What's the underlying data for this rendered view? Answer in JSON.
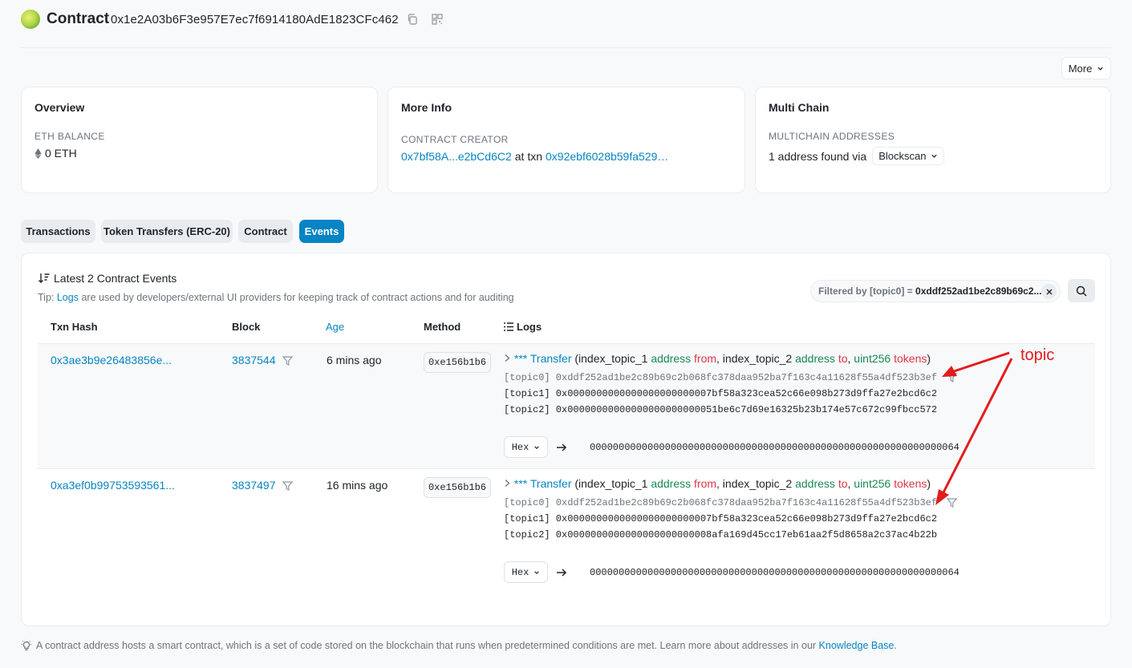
{
  "header": {
    "title": "Contract",
    "address": "0x1e2A03b6F3e957E7ec7f6914180AdE1823CFc462"
  },
  "more_button": "More",
  "overview": {
    "title": "Overview",
    "balance_label": "ETH BALANCE",
    "balance_value": "0 ETH"
  },
  "more_info": {
    "title": "More Info",
    "creator_label": "CONTRACT CREATOR",
    "creator_address": "0x7bf58A...e2bCd6C2",
    "at_txn": "at txn",
    "creator_txn": "0x92ebf6028b59fa529…"
  },
  "multi_chain": {
    "title": "Multi Chain",
    "label": "MULTICHAIN ADDRESSES",
    "value": "1 address found via",
    "dropdown": "Blockscan"
  },
  "tabs": [
    {
      "label": "Transactions"
    },
    {
      "label": "Token Transfers (ERC-20)"
    },
    {
      "label": "Contract"
    },
    {
      "label": "Events"
    }
  ],
  "events": {
    "title": "Latest 2 Contract Events",
    "tip_prefix": "Tip:",
    "tip_link": "Logs",
    "tip_text": "are used by developers/external UI providers for keeping track of contract actions and for auditing",
    "filter_label": "Filtered by [topic0] =",
    "filter_value": "0xddf252ad1be2c89b69c2...",
    "columns": {
      "txn_hash": "Txn Hash",
      "block": "Block",
      "age": "Age",
      "method": "Method",
      "logs": "Logs"
    },
    "rows": [
      {
        "txn_hash": "0x3ae3b9e26483856e...",
        "block": "3837544",
        "age": "6 mins ago",
        "method": "0xe156b1b6",
        "sig_prefix": "*** Transfer",
        "topic0": "[topic0] 0xddf252ad1be2c89b69c2b068fc378daa952ba7f163c4a11628f55a4df523b3ef",
        "topic1": "[topic1] 0x0000000000000000000000007bf58a323cea52c66e098b273d9ffa27e2bcd6c2",
        "topic2": "[topic2] 0x00000000000000000000000051be6c7d69e16325b23b174e57c672c99fbcc572",
        "hex": "Hex",
        "data": "0000000000000000000000000000000000000000000000000000000000000064"
      },
      {
        "txn_hash": "0xa3ef0b99753593561...",
        "block": "3837497",
        "age": "16 mins ago",
        "method": "0xe156b1b6",
        "sig_prefix": "*** Transfer",
        "topic0": "[topic0] 0xddf252ad1be2c89b69c2b068fc378daa952ba7f163c4a11628f55a4df523b3ef",
        "topic1": "[topic1] 0x0000000000000000000000007bf58a323cea52c66e098b273d9ffa27e2bcd6c2",
        "topic2": "[topic2] 0x0000000000000000000000008afa169d45cc17eb61aa2f5d8658a2c37ac4b22b",
        "hex": "Hex",
        "data": "0000000000000000000000000000000000000000000000000000000000000064"
      }
    ],
    "sig": {
      "open": "(index_topic_1",
      "type_addr": "address",
      "from": "from",
      "mid": ", index_topic_2",
      "to": "to",
      "type_uint": "uint256",
      "tokens": "tokens",
      "close": ")"
    }
  },
  "footer": {
    "text": "A contract address hosts a smart contract, which is a set of code stored on the blockchain that runs when predetermined conditions are met. Learn more about addresses in our",
    "link": "Knowledge Base",
    "end": "."
  },
  "annotation": {
    "label": "topic",
    "color": "#e31b1b"
  },
  "colors": {
    "accent": "#0784c3",
    "green": "#198754",
    "red": "#dc3545"
  }
}
